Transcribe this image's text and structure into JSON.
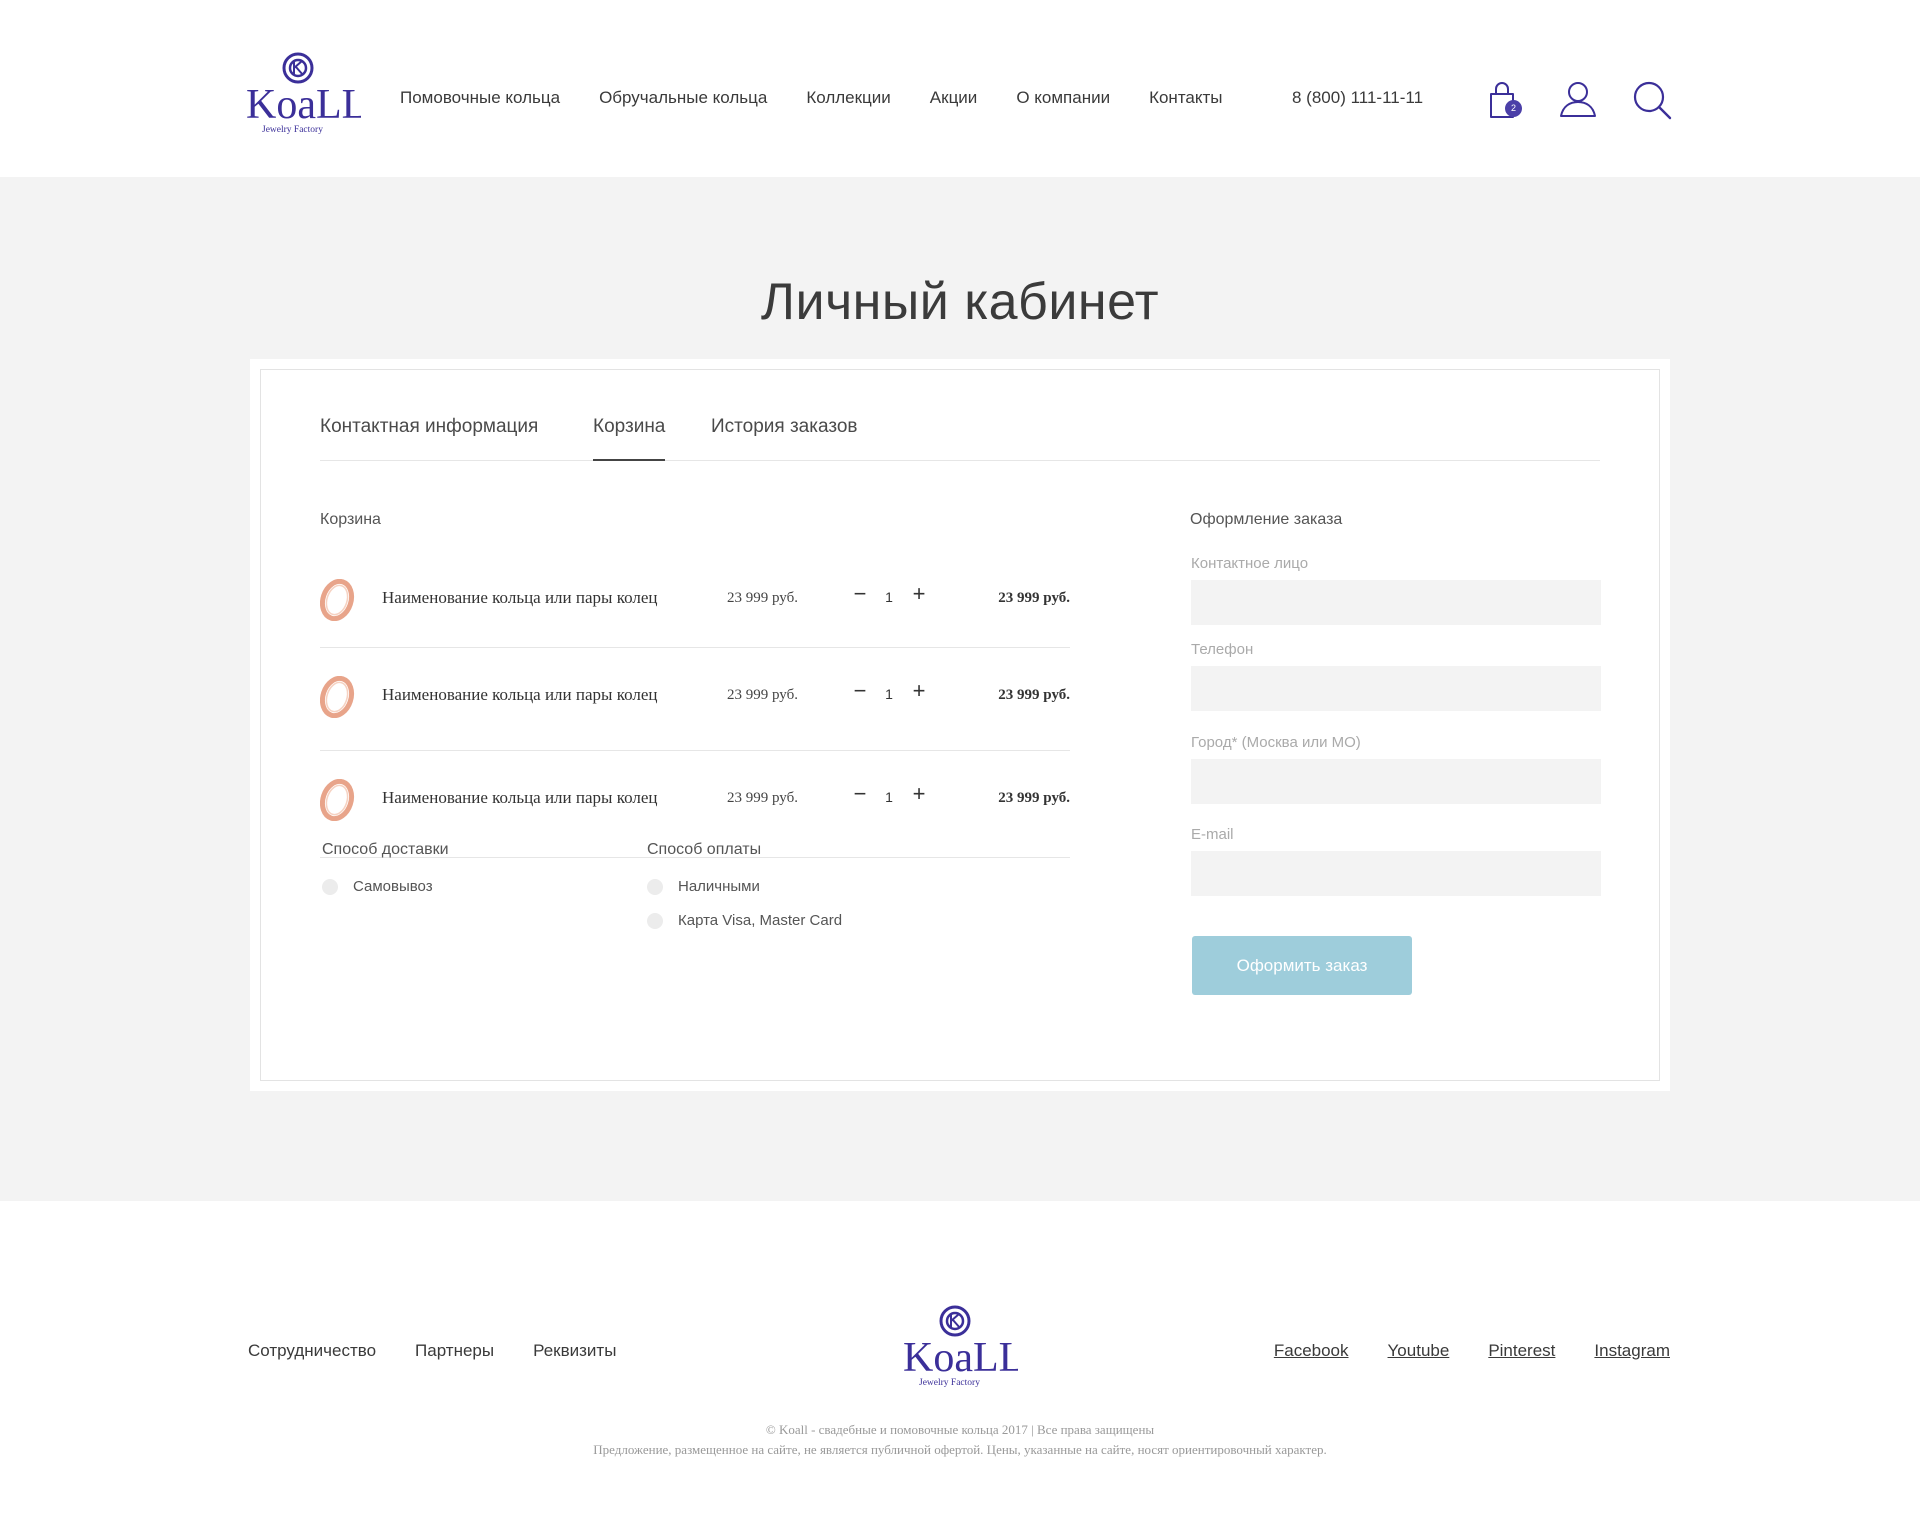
{
  "header": {
    "nav": [
      "Помовочные кольца",
      "Обручальные кольца",
      "Коллекции",
      "Акции",
      "О компании",
      "Контакты"
    ],
    "phone": "8 (800) 111-11-11",
    "cart_count": "2"
  },
  "logo": {
    "brand": "KoaLL",
    "tagline": "Jewelry Factory"
  },
  "page": {
    "title": "Личный кабинет"
  },
  "tabs": [
    {
      "label": "Контактная информация",
      "active": false
    },
    {
      "label": "Корзина",
      "active": true
    },
    {
      "label": "История заказов",
      "active": false
    }
  ],
  "cart": {
    "title": "Корзина",
    "items": [
      {
        "name": "Наименование кольца или пары колец",
        "price": "23 999 руб.",
        "qty": "1",
        "total": "23 999 руб.",
        "minus": "−",
        "plus": "+"
      },
      {
        "name": "Наименование кольца или пары колец",
        "price": "23 999 руб.",
        "qty": "1",
        "total": "23 999 руб.",
        "minus": "−",
        "plus": "+"
      },
      {
        "name": "Наименование кольца или пары колец",
        "price": "23 999 руб.",
        "qty": "1",
        "total": "23 999 руб.",
        "minus": "−",
        "plus": "+"
      }
    ]
  },
  "delivery": {
    "title": "Способ доставки",
    "options": [
      "Самовывоз"
    ]
  },
  "payment": {
    "title": "Способ оплаты",
    "options": [
      "Наличными",
      "Карта Visa, Master Card"
    ]
  },
  "order": {
    "title": "Оформление заказа",
    "fields": [
      {
        "label": "Контактное лицо",
        "value": ""
      },
      {
        "label": "Телефон",
        "value": ""
      },
      {
        "label": "Город* (Москва или МО)",
        "value": ""
      },
      {
        "label": "E-mail",
        "value": ""
      }
    ],
    "submit": "Оформить заказ"
  },
  "footer": {
    "links": [
      "Сотрудничество",
      "Партнеры",
      "Реквизиты"
    ],
    "social": [
      "Facebook",
      "Youtube",
      "Pinterest",
      "Instagram"
    ],
    "copyright": "© Koall - свадебные и помовочные кольца 2017 | Все права защищены",
    "disclaimer": "Предложение, размещенное на сайте, не является публичной офертой. Цены, указанные на сайте, носят ориентировочный характер."
  },
  "colors": {
    "brand": "#3b2f99",
    "accent_button": "#9ecddb",
    "page_bg": "#f3f3f3",
    "ring": "#e8a48a"
  },
  "icons": {
    "cart": "shopping-bag-icon",
    "user": "user-icon",
    "search": "search-icon",
    "item": "ring-icon"
  }
}
